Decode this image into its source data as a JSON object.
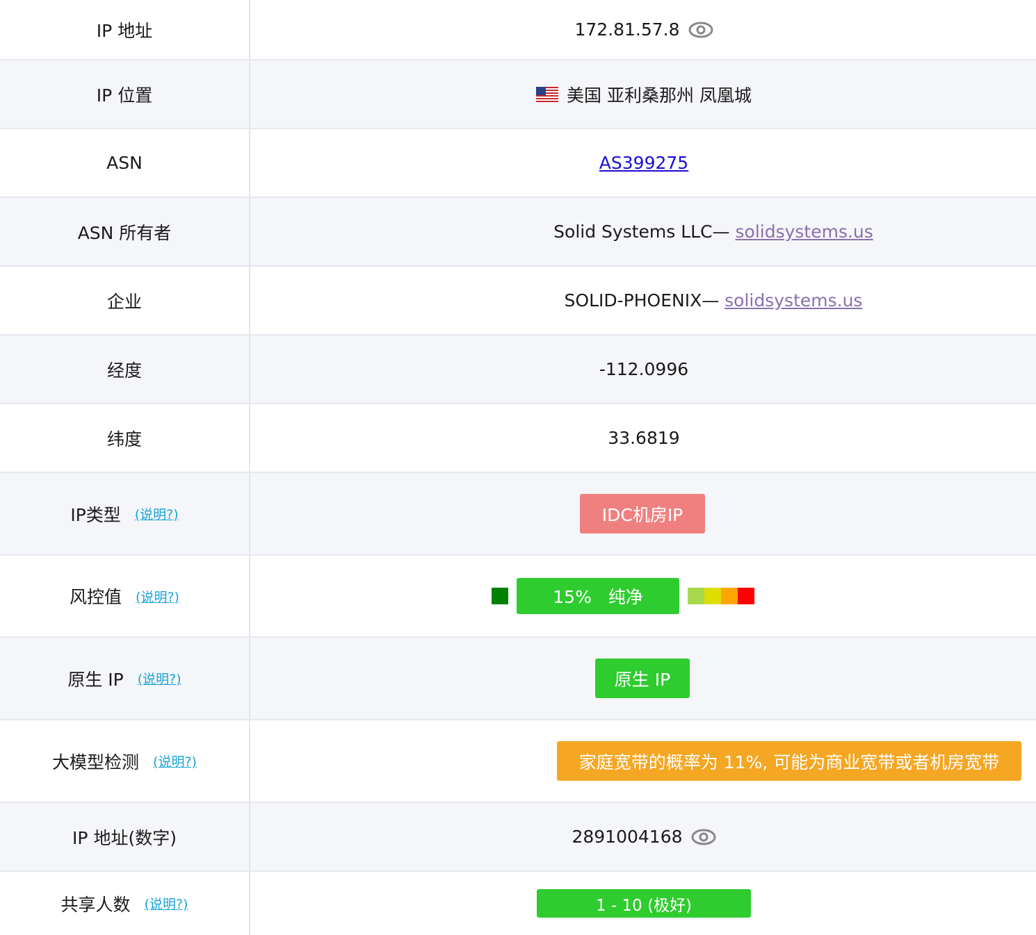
{
  "rows": [
    {
      "label": "IP 地址",
      "value": "172.81.57.8",
      "eye": "eye-icon"
    },
    {
      "label": "IP 位置",
      "flag": "us-flag-icon",
      "value": "美国 亚利桑那州 凤凰城"
    },
    {
      "label": "ASN",
      "link": "AS399275"
    },
    {
      "label": "ASN 所有者",
      "prefix": "Solid Systems LLC— ",
      "link": "solidsystems.us"
    },
    {
      "label": "企业",
      "prefix": "SOLID-PHOENIX— ",
      "link": "solidsystems.us"
    },
    {
      "label": "经度",
      "value": "-112.0996"
    },
    {
      "label": "纬度",
      "value": "33.6819"
    },
    {
      "label": "IP类型",
      "help": "(说明?)",
      "badge": "IDC机房IP"
    },
    {
      "label": "风控值",
      "help": "(说明?)",
      "badge": "15%   纯净",
      "risk_level_color": "#008000",
      "risk_scale_colors": [
        "#a8d84e",
        "#dede00",
        "#ffa500",
        "#ff0000"
      ]
    },
    {
      "label": "原生 IP",
      "help": "(说明?)",
      "badge": "原生 IP"
    },
    {
      "label": "大模型检测",
      "help": "(说明?)",
      "badge": "家庭宽带的概率为 11%, 可能为商业宽带或者机房宽带"
    },
    {
      "label": "IP 地址(数字)",
      "value": "2891004168",
      "eye": "eye-icon"
    },
    {
      "label": "共享人数",
      "help": "(说明?)",
      "badge": "1 - 10 (极好)"
    }
  ],
  "colors": {
    "idc_badge": "#f08080",
    "green_badge": "#2ecc2e",
    "orange_badge": "#f5a623",
    "help_link": "#19a3d8",
    "asn_link": "#1a0dd8",
    "site_link": "#8a6fae"
  }
}
